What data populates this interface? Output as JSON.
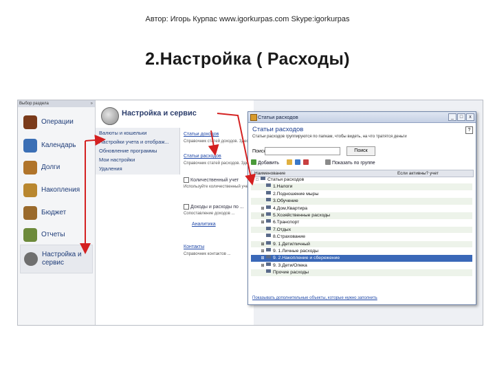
{
  "slide": {
    "author": "Автор: Игорь Курпас www.igorkurpas.com Skype:igorkurpas",
    "title": "2.Настройка ( Расходы)"
  },
  "nav": {
    "title": "Выбор раздела",
    "close": "»",
    "items": [
      {
        "label": "Операции",
        "icon": "chest-icon",
        "color": "#7a3a1a"
      },
      {
        "label": "Календарь",
        "icon": "calendar-icon",
        "color": "#3b6fb5"
      },
      {
        "label": "Долги",
        "icon": "people-icon",
        "color": "#b0742a"
      },
      {
        "label": "Накопления",
        "icon": "box-icon",
        "color": "#b9872f"
      },
      {
        "label": "Бюджет",
        "icon": "wallet-icon",
        "color": "#9a6a2c"
      },
      {
        "label": "Отчеты",
        "icon": "report-icon",
        "color": "#6d8a3b"
      },
      {
        "label": "Настройка и сервис",
        "icon": "gear-icon",
        "color": "#6f6f6f"
      }
    ]
  },
  "mid": {
    "title": "Настройка и сервис",
    "items": [
      "Валюты и кошельки",
      "Настройки учета и отображ...",
      "Обновление программы",
      "Мои настройки",
      "Удаления"
    ],
    "right": {
      "link1": "Статьи доходов",
      "text1": "Справочник статей доходов. Здесь вы можете ...",
      "link2": "Статьи расходов",
      "text2": "Справочник статей расходов. Здесь вы можете ...",
      "check1": "Количественный учет",
      "text3": "Используйте количественный учет ...",
      "check2": "Доходы и расходы по ...",
      "text4": "Сопоставление доходов ...",
      "link3": "Аналитика",
      "link4": "Контакты",
      "text5": "Справочник контактов ..."
    }
  },
  "dialog": {
    "bar_title": "Статьи расходов",
    "buttons": {
      "min": "_",
      "max": "□",
      "close": "x"
    },
    "heading": "Статьи расходов",
    "help": "?",
    "description": "Статьи расходов группируются по папкам, чтобы видеть, на что тратятся деньги",
    "search_label": "Поиск:",
    "search_value": "",
    "search_button": "Поиск",
    "toolbar": {
      "add": "Добавить",
      "show_groups": "Показать по группе"
    },
    "columns": {
      "name": "Наименование",
      "active": "Если активны? учет"
    },
    "tree": [
      {
        "text": "Статьи расходов",
        "exp": "□",
        "level": 0
      },
      {
        "text": "1.Налоги",
        "exp": "",
        "level": 1
      },
      {
        "text": "2.Подношение мыры",
        "exp": "",
        "level": 1
      },
      {
        "text": "3.Обучение",
        "exp": "",
        "level": 1
      },
      {
        "text": "4.Дом,Квартира",
        "exp": "⊞",
        "level": 1
      },
      {
        "text": "5.Хозяйственные расходы",
        "exp": "⊞",
        "level": 1
      },
      {
        "text": "6.Транспорт",
        "exp": "⊞",
        "level": 1
      },
      {
        "text": "7.Отдых",
        "exp": "",
        "level": 1
      },
      {
        "text": "8.Страхование",
        "exp": "",
        "level": 1
      },
      {
        "text": "9. 1.Дети/личный",
        "exp": "⊞",
        "level": 1
      },
      {
        "text": "9. 1.Личные расходы",
        "exp": "⊞",
        "level": 1
      },
      {
        "text": "9. 2.Накопление и сбережение",
        "exp": "⊞",
        "level": 1,
        "selected": true
      },
      {
        "text": "9. 3.Дети/Опека",
        "exp": "⊞",
        "level": 1
      },
      {
        "text": "Прочие расходы",
        "exp": "",
        "level": 1
      }
    ],
    "footer": "Показывать дополнительные объекты, которые нужно заполнить"
  },
  "colors": {
    "accent": "#1a3d8f",
    "selection": "#3a68b8",
    "arrow": "#d42020"
  }
}
